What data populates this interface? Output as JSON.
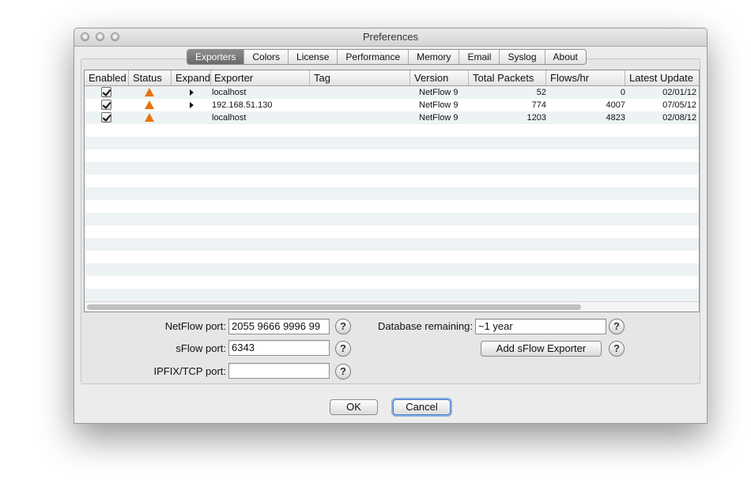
{
  "window": {
    "title": "Preferences"
  },
  "tabs": [
    {
      "label": "Exporters",
      "active": true
    },
    {
      "label": "Colors"
    },
    {
      "label": "License"
    },
    {
      "label": "Performance"
    },
    {
      "label": "Memory"
    },
    {
      "label": "Email"
    },
    {
      "label": "Syslog"
    },
    {
      "label": "About"
    }
  ],
  "table": {
    "columns": [
      "Enabled",
      "Status",
      "Expand",
      "Exporter",
      "Tag",
      "Version",
      "Total Packets",
      "Flows/hr",
      "Latest Update"
    ],
    "rows": [
      {
        "enabled": true,
        "status_icon": "warning-triangle-icon",
        "expandable": true,
        "exporter": "localhost",
        "tag": "",
        "version": "NetFlow 9",
        "total_packets": "52",
        "flows_hr": "0",
        "latest_update": "02/01/12"
      },
      {
        "enabled": true,
        "status_icon": "warning-triangle-icon",
        "expandable": true,
        "exporter": "192.168.51.130",
        "tag": "",
        "version": "NetFlow 9",
        "total_packets": "774",
        "flows_hr": "4007",
        "latest_update": "07/05/12"
      },
      {
        "enabled": true,
        "status_icon": "warning-triangle-icon",
        "expandable": false,
        "exporter": "localhost",
        "tag": "",
        "version": "NetFlow 9",
        "total_packets": "1203",
        "flows_hr": "4823",
        "latest_update": "02/08/12"
      }
    ]
  },
  "form": {
    "netflow_label": "NetFlow port:",
    "netflow_value": "2055 9666 9996 99",
    "sflow_label": "sFlow port:",
    "sflow_value": "6343",
    "ipfix_label": "IPFIX/TCP port:",
    "ipfix_value": "",
    "db_label": "Database remaining:",
    "db_value": "~1 year",
    "add_sflow_label": "Add sFlow Exporter",
    "help_glyph": "?"
  },
  "buttons": {
    "ok": "OK",
    "cancel": "Cancel"
  },
  "colors": {
    "warning": "#e8730c",
    "row_alt": "#edf3f4",
    "active_tab": "#7a7a7a",
    "focus_ring": "#8fb3e8"
  }
}
